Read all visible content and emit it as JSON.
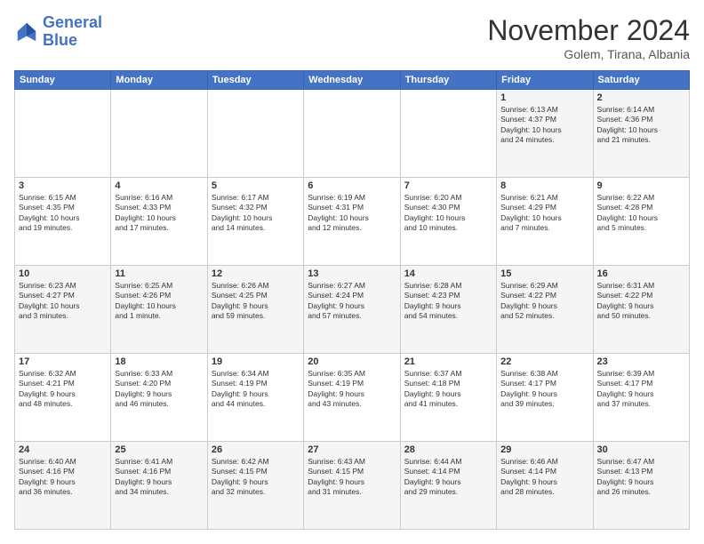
{
  "logo": {
    "line1": "General",
    "line2": "Blue"
  },
  "title": "November 2024",
  "subtitle": "Golem, Tirana, Albania",
  "days_header": [
    "Sunday",
    "Monday",
    "Tuesday",
    "Wednesday",
    "Thursday",
    "Friday",
    "Saturday"
  ],
  "weeks": [
    [
      {
        "day": "",
        "info": ""
      },
      {
        "day": "",
        "info": ""
      },
      {
        "day": "",
        "info": ""
      },
      {
        "day": "",
        "info": ""
      },
      {
        "day": "",
        "info": ""
      },
      {
        "day": "1",
        "info": "Sunrise: 6:13 AM\nSunset: 4:37 PM\nDaylight: 10 hours\nand 24 minutes."
      },
      {
        "day": "2",
        "info": "Sunrise: 6:14 AM\nSunset: 4:36 PM\nDaylight: 10 hours\nand 21 minutes."
      }
    ],
    [
      {
        "day": "3",
        "info": "Sunrise: 6:15 AM\nSunset: 4:35 PM\nDaylight: 10 hours\nand 19 minutes."
      },
      {
        "day": "4",
        "info": "Sunrise: 6:16 AM\nSunset: 4:33 PM\nDaylight: 10 hours\nand 17 minutes."
      },
      {
        "day": "5",
        "info": "Sunrise: 6:17 AM\nSunset: 4:32 PM\nDaylight: 10 hours\nand 14 minutes."
      },
      {
        "day": "6",
        "info": "Sunrise: 6:19 AM\nSunset: 4:31 PM\nDaylight: 10 hours\nand 12 minutes."
      },
      {
        "day": "7",
        "info": "Sunrise: 6:20 AM\nSunset: 4:30 PM\nDaylight: 10 hours\nand 10 minutes."
      },
      {
        "day": "8",
        "info": "Sunrise: 6:21 AM\nSunset: 4:29 PM\nDaylight: 10 hours\nand 7 minutes."
      },
      {
        "day": "9",
        "info": "Sunrise: 6:22 AM\nSunset: 4:28 PM\nDaylight: 10 hours\nand 5 minutes."
      }
    ],
    [
      {
        "day": "10",
        "info": "Sunrise: 6:23 AM\nSunset: 4:27 PM\nDaylight: 10 hours\nand 3 minutes."
      },
      {
        "day": "11",
        "info": "Sunrise: 6:25 AM\nSunset: 4:26 PM\nDaylight: 10 hours\nand 1 minute."
      },
      {
        "day": "12",
        "info": "Sunrise: 6:26 AM\nSunset: 4:25 PM\nDaylight: 9 hours\nand 59 minutes."
      },
      {
        "day": "13",
        "info": "Sunrise: 6:27 AM\nSunset: 4:24 PM\nDaylight: 9 hours\nand 57 minutes."
      },
      {
        "day": "14",
        "info": "Sunrise: 6:28 AM\nSunset: 4:23 PM\nDaylight: 9 hours\nand 54 minutes."
      },
      {
        "day": "15",
        "info": "Sunrise: 6:29 AM\nSunset: 4:22 PM\nDaylight: 9 hours\nand 52 minutes."
      },
      {
        "day": "16",
        "info": "Sunrise: 6:31 AM\nSunset: 4:22 PM\nDaylight: 9 hours\nand 50 minutes."
      }
    ],
    [
      {
        "day": "17",
        "info": "Sunrise: 6:32 AM\nSunset: 4:21 PM\nDaylight: 9 hours\nand 48 minutes."
      },
      {
        "day": "18",
        "info": "Sunrise: 6:33 AM\nSunset: 4:20 PM\nDaylight: 9 hours\nand 46 minutes."
      },
      {
        "day": "19",
        "info": "Sunrise: 6:34 AM\nSunset: 4:19 PM\nDaylight: 9 hours\nand 44 minutes."
      },
      {
        "day": "20",
        "info": "Sunrise: 6:35 AM\nSunset: 4:19 PM\nDaylight: 9 hours\nand 43 minutes."
      },
      {
        "day": "21",
        "info": "Sunrise: 6:37 AM\nSunset: 4:18 PM\nDaylight: 9 hours\nand 41 minutes."
      },
      {
        "day": "22",
        "info": "Sunrise: 6:38 AM\nSunset: 4:17 PM\nDaylight: 9 hours\nand 39 minutes."
      },
      {
        "day": "23",
        "info": "Sunrise: 6:39 AM\nSunset: 4:17 PM\nDaylight: 9 hours\nand 37 minutes."
      }
    ],
    [
      {
        "day": "24",
        "info": "Sunrise: 6:40 AM\nSunset: 4:16 PM\nDaylight: 9 hours\nand 36 minutes."
      },
      {
        "day": "25",
        "info": "Sunrise: 6:41 AM\nSunset: 4:16 PM\nDaylight: 9 hours\nand 34 minutes."
      },
      {
        "day": "26",
        "info": "Sunrise: 6:42 AM\nSunset: 4:15 PM\nDaylight: 9 hours\nand 32 minutes."
      },
      {
        "day": "27",
        "info": "Sunrise: 6:43 AM\nSunset: 4:15 PM\nDaylight: 9 hours\nand 31 minutes."
      },
      {
        "day": "28",
        "info": "Sunrise: 6:44 AM\nSunset: 4:14 PM\nDaylight: 9 hours\nand 29 minutes."
      },
      {
        "day": "29",
        "info": "Sunrise: 6:46 AM\nSunset: 4:14 PM\nDaylight: 9 hours\nand 28 minutes."
      },
      {
        "day": "30",
        "info": "Sunrise: 6:47 AM\nSunset: 4:13 PM\nDaylight: 9 hours\nand 26 minutes."
      }
    ]
  ]
}
